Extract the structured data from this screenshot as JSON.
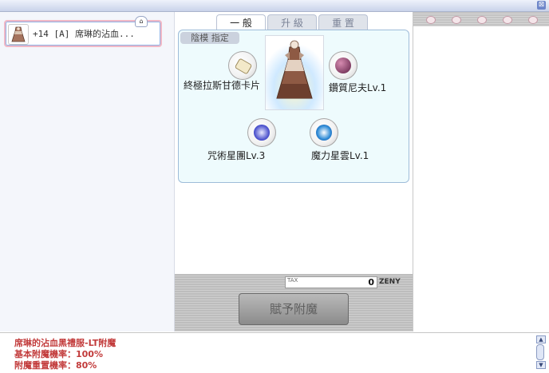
{
  "window": {
    "close_label": "⊠"
  },
  "item": {
    "name": "+14 [A] 席琳的沾血...",
    "flag": "⌂"
  },
  "tabs": [
    {
      "label": "一 般"
    },
    {
      "label": "升 級"
    },
    {
      "label": "重 置"
    }
  ],
  "slot": {
    "label": "陰模 指定"
  },
  "enchants": [
    {
      "label": "終極拉斯甘德卡片",
      "icon": "card-icon"
    },
    {
      "label": "鑽質尼夫Lv.1",
      "icon": "gem-icon"
    },
    {
      "label": "咒術星團Lv.3",
      "icon": "star-orb-icon"
    },
    {
      "label": "魔力星雲Lv.1",
      "icon": "nebula-orb-icon"
    }
  ],
  "tax": {
    "label": "TAX",
    "value": "0",
    "currency": "ZENY"
  },
  "apply_button": {
    "label": "賦予附魔"
  },
  "footer": {
    "line1": "席琳的沾血黑禮服-LT附魔",
    "line2": "基本附魔機率：100%",
    "line3": "附魔重置機率：80%"
  },
  "colors": {
    "panel_bg": "#eefbfd",
    "footer_text": "#c23b3b",
    "tab_active": "#ffffff",
    "tab_inactive": "#dfe3ea"
  }
}
